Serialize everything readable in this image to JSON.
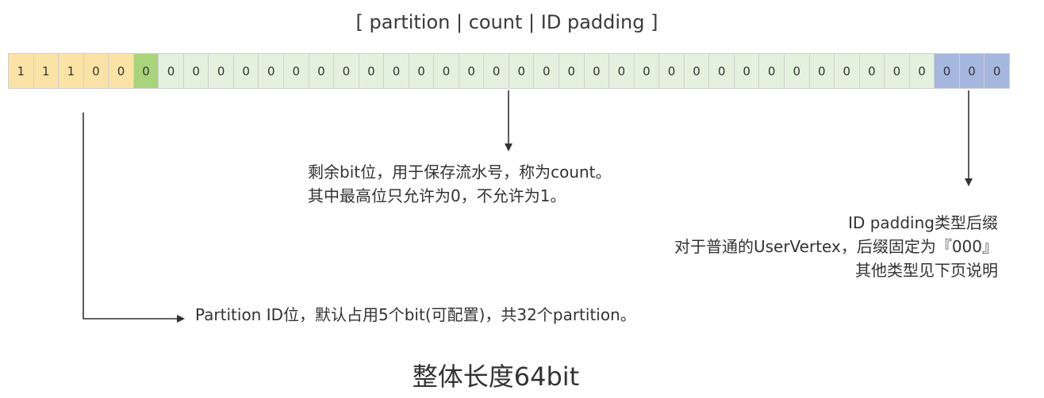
{
  "header": {
    "title": "[ partition | count | ID padding ]"
  },
  "bits": [
    {
      "value": "1",
      "segment": "partition"
    },
    {
      "value": "1",
      "segment": "partition"
    },
    {
      "value": "1",
      "segment": "partition"
    },
    {
      "value": "0",
      "segment": "partition"
    },
    {
      "value": "0",
      "segment": "partition"
    },
    {
      "value": "0",
      "segment": "count-high"
    },
    {
      "value": "0",
      "segment": "count"
    },
    {
      "value": "0",
      "segment": "count"
    },
    {
      "value": "0",
      "segment": "count"
    },
    {
      "value": "0",
      "segment": "count"
    },
    {
      "value": "0",
      "segment": "count"
    },
    {
      "value": "0",
      "segment": "count"
    },
    {
      "value": "0",
      "segment": "count"
    },
    {
      "value": "0",
      "segment": "count"
    },
    {
      "value": "0",
      "segment": "count"
    },
    {
      "value": "0",
      "segment": "count"
    },
    {
      "value": "0",
      "segment": "count"
    },
    {
      "value": "0",
      "segment": "count"
    },
    {
      "value": "0",
      "segment": "count"
    },
    {
      "value": "0",
      "segment": "count"
    },
    {
      "value": "0",
      "segment": "count"
    },
    {
      "value": "0",
      "segment": "count"
    },
    {
      "value": "0",
      "segment": "count"
    },
    {
      "value": "0",
      "segment": "count"
    },
    {
      "value": "0",
      "segment": "count"
    },
    {
      "value": "0",
      "segment": "count"
    },
    {
      "value": "0",
      "segment": "count"
    },
    {
      "value": "0",
      "segment": "count"
    },
    {
      "value": "0",
      "segment": "count"
    },
    {
      "value": "0",
      "segment": "count"
    },
    {
      "value": "0",
      "segment": "count"
    },
    {
      "value": "0",
      "segment": "count"
    },
    {
      "value": "0",
      "segment": "count"
    },
    {
      "value": "0",
      "segment": "count"
    },
    {
      "value": "0",
      "segment": "count"
    },
    {
      "value": "0",
      "segment": "count"
    },
    {
      "value": "0",
      "segment": "count"
    },
    {
      "value": "0",
      "segment": "padding"
    },
    {
      "value": "0",
      "segment": "padding"
    },
    {
      "value": "0",
      "segment": "padding"
    }
  ],
  "colors": {
    "partition": "#fbe3a6",
    "count_high": "#a8d47a",
    "count": "#e4f1de",
    "padding": "#a6b7df"
  },
  "notes": {
    "count": {
      "line1": "剩余bit位，用于保存流水号，称为count。",
      "line2": "其中最高位只允许为0，不允许为1。"
    },
    "padding": {
      "line1": "ID padding类型后缀",
      "line2": "对于普通的UserVertex，后缀固定为『000』",
      "line3": "其他类型见下页说明"
    },
    "partition": {
      "text": "Partition ID位，默认占用5个bit(可配置)，共32个partition。"
    }
  },
  "footer": {
    "title": "整体长度64bit"
  }
}
